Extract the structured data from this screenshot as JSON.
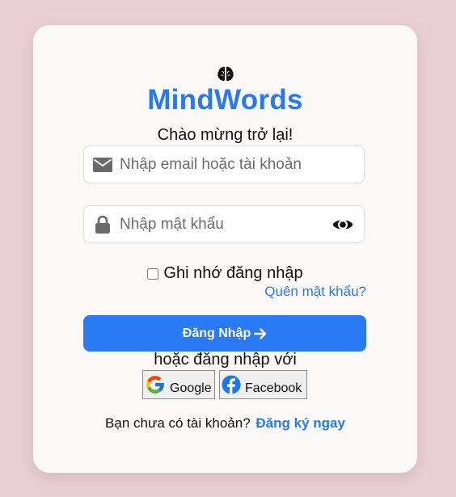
{
  "app": {
    "title": "MindWords",
    "logo_icon": "brain-icon",
    "welcome": "Chào mừng trở lại!"
  },
  "login_form": {
    "email": {
      "icon": "envelope-icon",
      "placeholder": "Nhập email hoặc tài khoản",
      "value": ""
    },
    "password": {
      "icon": "lock-icon",
      "placeholder": "Nhập mật khẩu",
      "value": "",
      "toggle_icon": "eye-icon"
    },
    "remember_label": "Ghi nhớ đăng nhập",
    "remember_checked": false,
    "forgot_link": "Quên mật khẩu?",
    "submit_label": "Đăng Nhập",
    "submit_icon": "arrow-right-icon"
  },
  "social_login": {
    "prompt": "hoặc đăng nhập với",
    "google_label": "Google",
    "facebook_label": "Facebook"
  },
  "signup": {
    "prompt": "Bạn chưa có tài khoản?",
    "link": "Đăng ký ngay"
  },
  "colors": {
    "background": "#e9cfd3",
    "card": "#fbf9f8",
    "accent": "#2878ee",
    "button": "#2a79f5"
  }
}
